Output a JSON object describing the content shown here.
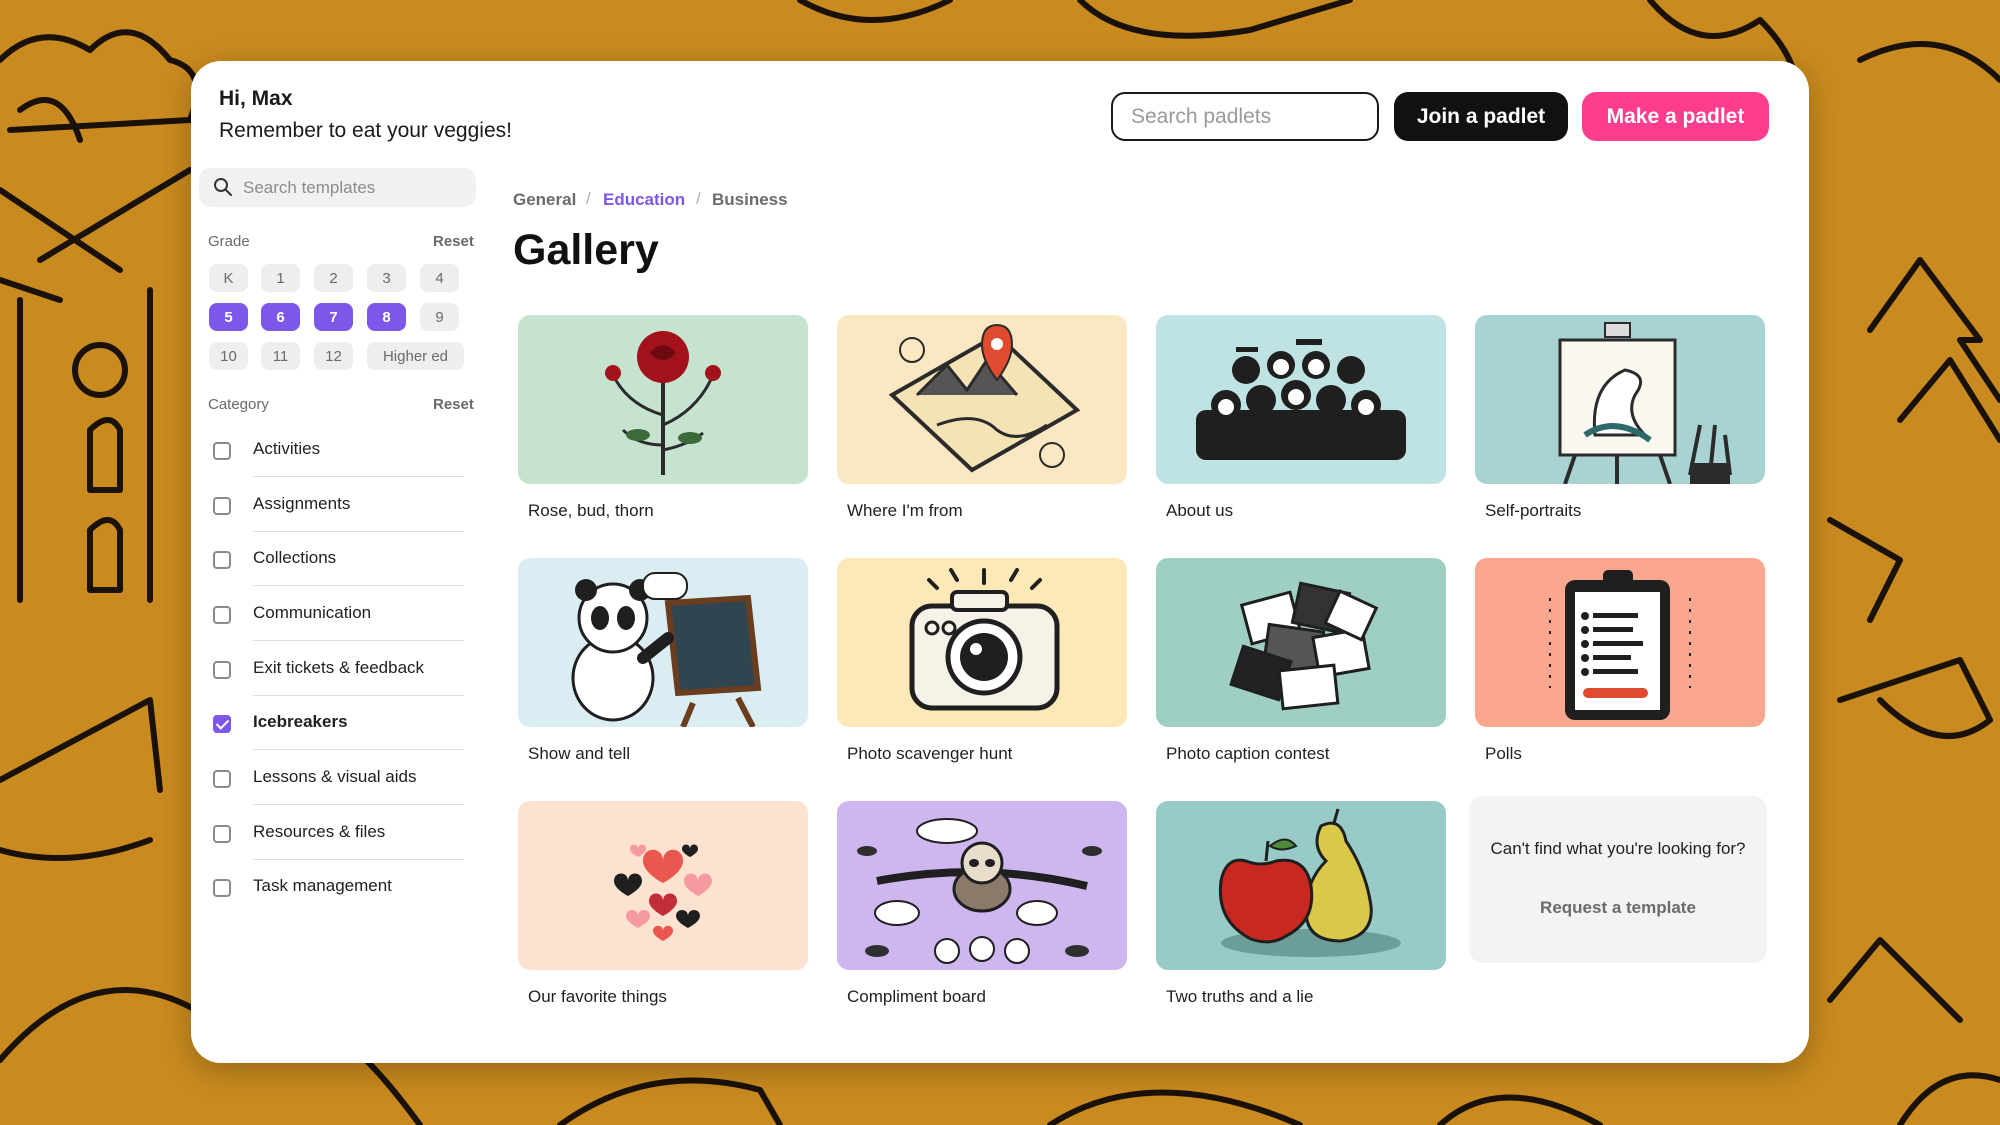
{
  "header": {
    "greeting": "Hi, Max",
    "message": "Remember to eat your veggies!",
    "search_placeholder": "Search padlets",
    "join_label": "Join a padlet",
    "make_label": "Make a padlet"
  },
  "sidebar": {
    "search_placeholder": "Search templates",
    "grade_label": "Grade",
    "grade_reset": "Reset",
    "grades": [
      {
        "label": "K",
        "selected": false
      },
      {
        "label": "1",
        "selected": false
      },
      {
        "label": "2",
        "selected": false
      },
      {
        "label": "3",
        "selected": false
      },
      {
        "label": "4",
        "selected": false
      },
      {
        "label": "5",
        "selected": true
      },
      {
        "label": "6",
        "selected": true
      },
      {
        "label": "7",
        "selected": true
      },
      {
        "label": "8",
        "selected": true
      },
      {
        "label": "9",
        "selected": false
      },
      {
        "label": "10",
        "selected": false
      },
      {
        "label": "11",
        "selected": false
      },
      {
        "label": "12",
        "selected": false
      },
      {
        "label": "Higher ed",
        "selected": false
      }
    ],
    "category_label": "Category",
    "category_reset": "Reset",
    "categories": [
      {
        "label": "Activities",
        "checked": false
      },
      {
        "label": "Assignments",
        "checked": false
      },
      {
        "label": "Collections",
        "checked": false
      },
      {
        "label": "Communication",
        "checked": false
      },
      {
        "label": "Exit tickets & feedback",
        "checked": false
      },
      {
        "label": "Icebreakers",
        "checked": true
      },
      {
        "label": "Lessons & visual aids",
        "checked": false
      },
      {
        "label": "Resources & files",
        "checked": false
      },
      {
        "label": "Task management",
        "checked": false
      }
    ]
  },
  "main": {
    "breadcrumb": [
      "General",
      "Education",
      "Business"
    ],
    "breadcrumb_active": "Education",
    "title": "Gallery",
    "tiles": [
      {
        "name": "Rose, bud, thorn",
        "bg": "#c6e3cf",
        "icon": "rose-icon"
      },
      {
        "name": "Where I'm from",
        "bg": "#fbe7c2",
        "icon": "map-icon"
      },
      {
        "name": "About us",
        "bg": "#bfe3e3",
        "icon": "class-photo-icon"
      },
      {
        "name": "Self-portraits",
        "bg": "#a9d3d3",
        "icon": "easel-icon"
      },
      {
        "name": "Show and tell",
        "bg": "#d9edf3",
        "icon": "panda-icon"
      },
      {
        "name": "Photo scavenger hunt",
        "bg": "#fde9b8",
        "icon": "camera-icon"
      },
      {
        "name": "Photo caption contest",
        "bg": "#9fcfc2",
        "icon": "photo-pile-icon"
      },
      {
        "name": "Polls",
        "bg": "#fba78f",
        "icon": "poll-clipboard-icon"
      },
      {
        "name": "Our favorite things",
        "bg": "#fde3cf",
        "icon": "hearts-icon"
      },
      {
        "name": "Compliment board",
        "bg": "#cdb7ee",
        "icon": "sloth-icon"
      },
      {
        "name": "Two truths and a lie",
        "bg": "#98cac7",
        "icon": "apple-pear-icon"
      }
    ],
    "request": {
      "question": "Can't find what you're looking for?",
      "link": "Request a template"
    }
  }
}
